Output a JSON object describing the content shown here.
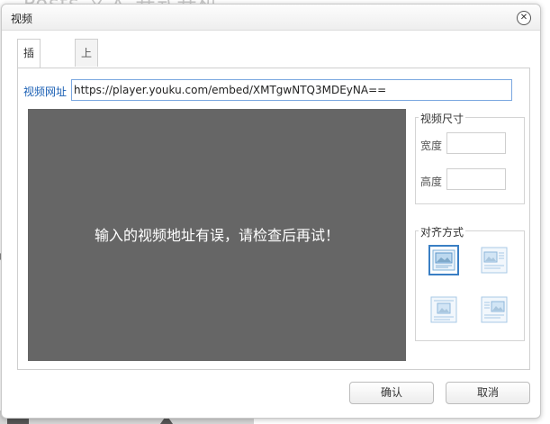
{
  "background": {
    "page_title": "Posts 义入 开式开机"
  },
  "dialog": {
    "title": "视频",
    "close_glyph": "✕"
  },
  "tabs": [
    {
      "label": "插入视频",
      "active": true
    },
    {
      "label": "上传视频",
      "active": false
    }
  ],
  "url": {
    "label": "视频网址",
    "value": "https://player.youku.com/embed/XMTgwNTQ3MDEyNA=="
  },
  "preview": {
    "message": "输入的视频地址有误，请检查后再试！"
  },
  "size": {
    "legend": "视频尺寸",
    "width_label": "宽度",
    "width_value": "",
    "height_label": "高度",
    "height_value": ""
  },
  "align": {
    "legend": "对齐方式",
    "options": [
      {
        "icon": "align-none-icon",
        "selected": true
      },
      {
        "icon": "align-left-icon",
        "selected": false
      },
      {
        "icon": "align-center-icon",
        "selected": false
      },
      {
        "icon": "align-right-icon",
        "selected": false
      }
    ]
  },
  "buttons": {
    "ok": "确认",
    "cancel": "取消"
  },
  "colors": {
    "preview_bg": "#666666",
    "label_blue": "#1a5fb4",
    "selected_border": "#3a7fc4"
  }
}
